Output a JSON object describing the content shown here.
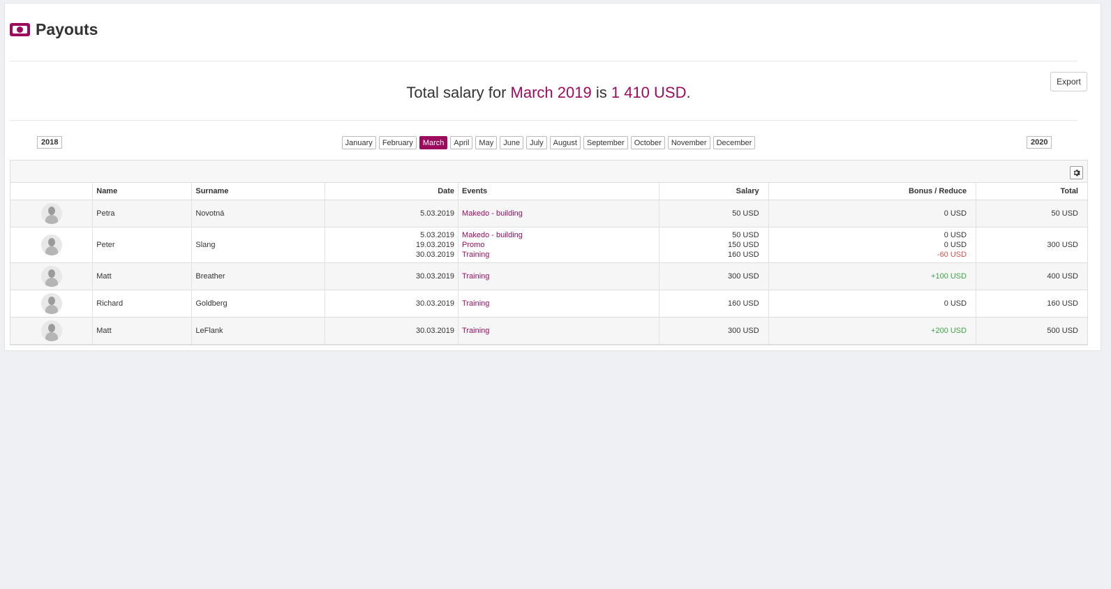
{
  "header": {
    "title": "Payouts",
    "icon": "money-icon"
  },
  "summary": {
    "prefix": "Total salary for ",
    "period": "March 2019",
    "middle": " is ",
    "amount": "1 410 USD",
    "suffix": "."
  },
  "toolbar": {
    "export_label": "Export"
  },
  "year_nav": {
    "prev": "2018",
    "next": "2020"
  },
  "months": [
    "January",
    "February",
    "March",
    "April",
    "May",
    "June",
    "July",
    "August",
    "September",
    "October",
    "November",
    "December"
  ],
  "active_month": "March",
  "table": {
    "columns": [
      "",
      "Name",
      "Surname",
      "Date",
      "Events",
      "Salary",
      "Bonus / Reduce",
      "Total"
    ],
    "rows": [
      {
        "name": "Petra",
        "surname": "Novotná",
        "entries": [
          {
            "date": "5.03.2019",
            "event": "Makedo - building",
            "salary": "50 USD",
            "bonus": "0 USD",
            "bonus_type": "zero"
          }
        ],
        "total": "50 USD"
      },
      {
        "name": "Peter",
        "surname": "Slang",
        "entries": [
          {
            "date": "5.03.2019",
            "event": "Makedo - building",
            "salary": "50 USD",
            "bonus": "0 USD",
            "bonus_type": "zero"
          },
          {
            "date": "19.03.2019",
            "event": "Promo",
            "salary": "150 USD",
            "bonus": "0 USD",
            "bonus_type": "zero"
          },
          {
            "date": "30.03.2019",
            "event": "Training",
            "salary": "160 USD",
            "bonus": "-60 USD",
            "bonus_type": "neg"
          }
        ],
        "total": "300 USD"
      },
      {
        "name": "Matt",
        "surname": "Breather",
        "entries": [
          {
            "date": "30.03.2019",
            "event": "Training",
            "salary": "300 USD",
            "bonus": "+100 USD",
            "bonus_type": "pos"
          }
        ],
        "total": "400 USD"
      },
      {
        "name": "Richard",
        "surname": "Goldberg",
        "entries": [
          {
            "date": "30.03.2019",
            "event": "Training",
            "salary": "160 USD",
            "bonus": "0 USD",
            "bonus_type": "zero"
          }
        ],
        "total": "160 USD"
      },
      {
        "name": "Matt",
        "surname": "LeFlank",
        "entries": [
          {
            "date": "30.03.2019",
            "event": "Training",
            "salary": "300 USD",
            "bonus": "+200 USD",
            "bonus_type": "pos"
          }
        ],
        "total": "500 USD"
      }
    ]
  },
  "colors": {
    "accent": "#9c0b5e",
    "negative": "#d9534f",
    "positive": "#3ca544"
  }
}
